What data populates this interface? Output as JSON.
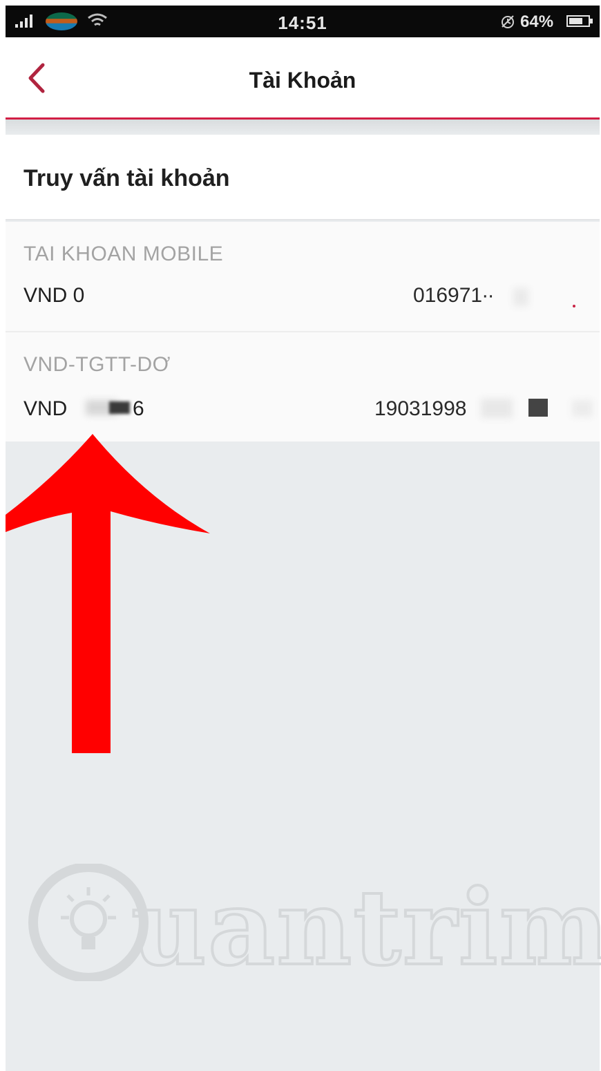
{
  "status_bar": {
    "time": "14:51",
    "battery": "64%",
    "icons": [
      "signal-icon",
      "carrier-logo-icon",
      "wifi-icon",
      "alarm-icon",
      "battery-icon"
    ]
  },
  "header": {
    "title": "Tài Khoản",
    "back_icon": "chevron-left-icon",
    "accent_color": "#d21f45"
  },
  "section": {
    "title": "Truy vấn tài khoản"
  },
  "accounts": [
    {
      "name": "TAI KHOAN MOBILE",
      "balance": "VND 0",
      "number": "016971∙∙"
    },
    {
      "name": "VND-TGTT-DƠ",
      "balance_prefix": "VND",
      "balance_suffix": "6",
      "number": "19031998"
    }
  ],
  "annotation": {
    "arrow_color": "#ff0000"
  },
  "watermark": {
    "text": "uantrimang",
    "icon": "lightbulb-icon"
  }
}
